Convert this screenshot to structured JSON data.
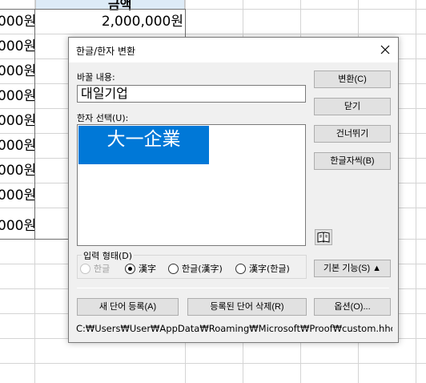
{
  "sheet": {
    "header_b_text": "금액",
    "col_a_values": [
      "000원",
      "000원",
      "000원",
      "000원",
      "000원",
      "000원",
      "000원",
      "000원",
      "000원"
    ],
    "col_b_value": "2,000,000원"
  },
  "dialog": {
    "title": "한글/한자 변환",
    "close_glyph": "✕",
    "input_label": "바꿀 내용:",
    "input_value": "대일기업",
    "list_label": "한자 선택(U):",
    "list_items": [
      "大一企業"
    ],
    "buttons": {
      "convert": "변환(C)",
      "close": "닫기",
      "skip": "건너뛰기",
      "dictionary": "한글자씩(B)",
      "basic": "기본 기능(S) ▲",
      "add_word": "새 단어 등록(A)",
      "delete_word": "등록된 단어 삭제(R)",
      "options": "옵션(O)..."
    },
    "input_form": {
      "legend": "입력 형태(D)",
      "options": [
        "한글",
        "漢字",
        "한글(漢字)",
        "漢字(한글)"
      ],
      "selected": "漢字"
    },
    "path": "C:₩Users₩User₩AppData₩Roaming₩Microsoft₩Proof₩custom.hhc"
  }
}
